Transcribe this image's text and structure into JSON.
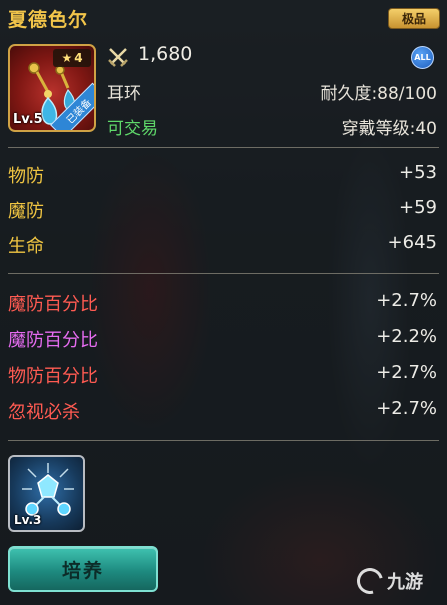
{
  "item": {
    "name": "夏德色尔",
    "quality": "极品",
    "stars": "4",
    "level": "Lv.5",
    "equipped": "已装备",
    "power": "1,680",
    "all_badge": "ALL",
    "type": "耳环",
    "durability": "耐久度:88/100",
    "tradeable": "可交易",
    "wear_level": "穿戴等级:40"
  },
  "base_stats": [
    {
      "name": "物防",
      "value": "+53"
    },
    {
      "name": "魔防",
      "value": "+59"
    },
    {
      "name": "生命",
      "value": "+645"
    }
  ],
  "extra_stats": [
    {
      "name": "魔防百分比",
      "value": "+2.7%",
      "color": "#ff5b52"
    },
    {
      "name": "魔防百分比",
      "value": "+2.2%",
      "color": "#e56cf0"
    },
    {
      "name": "物防百分比",
      "value": "+2.7%",
      "color": "#ff5b52"
    },
    {
      "name": "忽视必杀",
      "value": "+2.7%",
      "color": "#ff5b52"
    }
  ],
  "gem": {
    "level": "Lv.3",
    "icon": "crystal-gem-icon"
  },
  "actions": {
    "cultivate_label": "培养"
  },
  "watermark": "九游",
  "colors": {
    "title": "#f2c54a",
    "base_stat_label": "#f0c542",
    "tradeable": "#5fd86a"
  }
}
